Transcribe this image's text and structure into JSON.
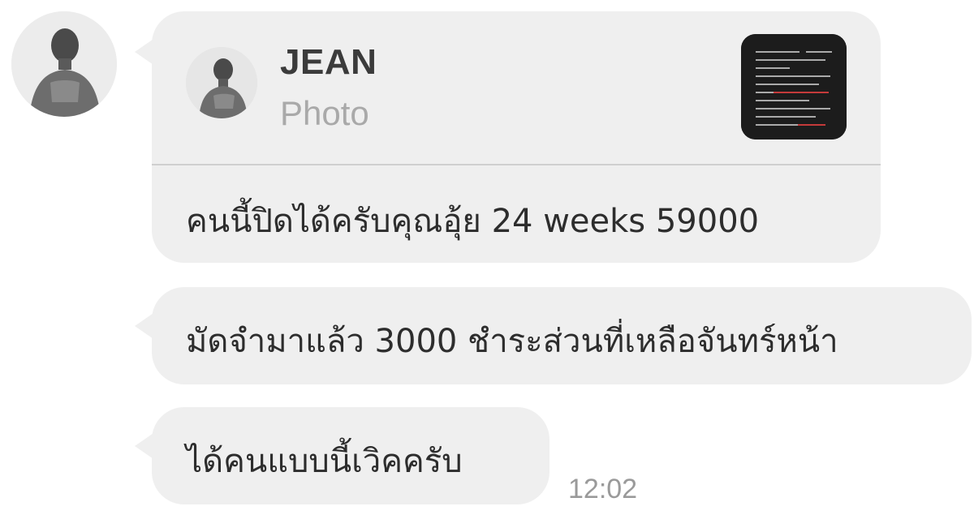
{
  "reply": {
    "name": "JEAN",
    "type": "Photo"
  },
  "messages": [
    {
      "text": "คนนี้ปิดได้ครับคุณอุ้ย 24 weeks 59000"
    },
    {
      "text": "มัดจำมาแล้ว 3000 ชำระส่วนที่เหลือจันทร์หน้า"
    },
    {
      "text": "ได้คนแบบนี้เวิคครับ"
    }
  ],
  "timestamp": "12:02",
  "icons": {
    "sender_avatar": "avatar-photo",
    "reply_avatar": "avatar-photo",
    "reply_thumbnail": "photo-thumbnail"
  },
  "colors": {
    "bubble": "#efefef",
    "text": "#2d2d2d",
    "muted": "#a9a9a9"
  }
}
